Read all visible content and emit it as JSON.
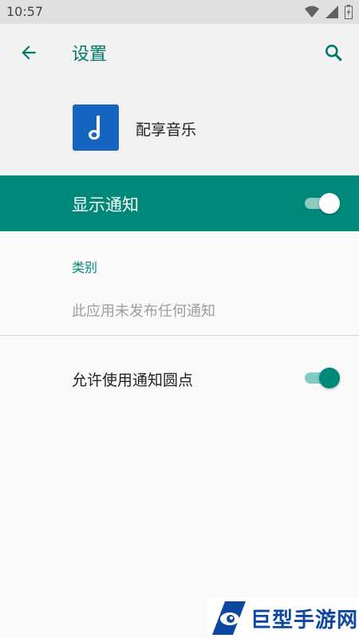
{
  "status_bar": {
    "time": "10:57"
  },
  "toolbar": {
    "title": "设置",
    "back_icon": "arrow-back-icon",
    "search_icon": "search-icon"
  },
  "app": {
    "name": "配享音乐",
    "icon": "music-note-icon",
    "icon_color": "#1565c0"
  },
  "notifications": {
    "label": "显示通知",
    "enabled": true
  },
  "categories": {
    "title": "类别",
    "empty_text": "此应用未发布任何通知"
  },
  "notification_dots": {
    "label": "允许使用通知圆点",
    "enabled": true
  },
  "watermark": {
    "text": "巨型手游网"
  },
  "colors": {
    "accent": "#00897b",
    "title": "#00796b",
    "muted": "#9e9e9e"
  }
}
